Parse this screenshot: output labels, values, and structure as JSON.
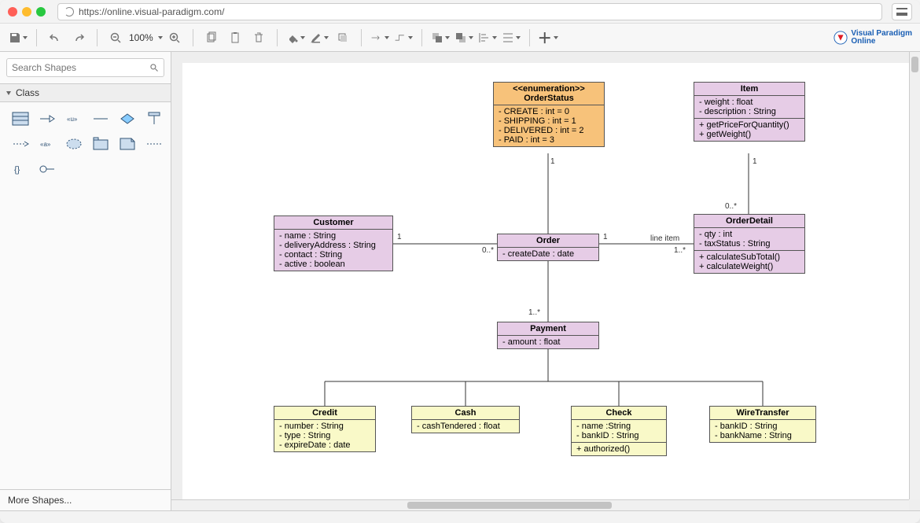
{
  "titlebar": {
    "url": "https://online.visual-paradigm.com/"
  },
  "topbar": {
    "zoom_label": "100%",
    "logo_line1": "Visual Paradigm",
    "logo_line2": "Online"
  },
  "sidebar": {
    "search_placeholder": "Search Shapes",
    "section_title": "Class",
    "more_shapes_label": "More Shapes..."
  },
  "edge_labels": {
    "status_1": "1",
    "item_1": "1",
    "detail_0n": "0..*",
    "cust_1": "1",
    "order_cust_0n": "0..*",
    "order_detail_1": "1",
    "detail_1n": "1..*",
    "line_item": "line item",
    "payment_1n": "1..*"
  },
  "classes": {
    "OrderStatus": {
      "stereotype": "<<enumeration>>",
      "name": "OrderStatus",
      "attrs": [
        "- CREATE : int  = 0",
        "- SHIPPING : int = 1",
        "- DELIVERED : int = 2",
        "- PAID : int = 3"
      ]
    },
    "Item": {
      "name": "Item",
      "attrs": [
        "- weight : float",
        "- description : String"
      ],
      "ops": [
        "+ getPriceForQuantity()",
        "+ getWeight()"
      ]
    },
    "Customer": {
      "name": "Customer",
      "attrs": [
        "- name : String",
        "- deliveryAddress : String",
        "- contact : String",
        "- active : boolean"
      ]
    },
    "Order": {
      "name": "Order",
      "attrs": [
        "- createDate : date"
      ]
    },
    "OrderDetail": {
      "name": "OrderDetail",
      "attrs": [
        "- qty : int",
        "- taxStatus : String"
      ],
      "ops": [
        "+ calculateSubTotal()",
        "+ calculateWeight()"
      ]
    },
    "Payment": {
      "name": "Payment",
      "attrs": [
        "- amount : float"
      ]
    },
    "Credit": {
      "name": "Credit",
      "attrs": [
        "- number : String",
        "- type : String",
        "- expireDate : date"
      ]
    },
    "Cash": {
      "name": "Cash",
      "attrs": [
        "- cashTendered : float"
      ]
    },
    "Check": {
      "name": "Check",
      "attrs": [
        "- name :String",
        "- bankID : String"
      ],
      "ops": [
        "+ authorized()"
      ]
    },
    "WireTransfer": {
      "name": "WireTransfer",
      "attrs": [
        "- bankID : String",
        "- bankName : String"
      ]
    }
  }
}
